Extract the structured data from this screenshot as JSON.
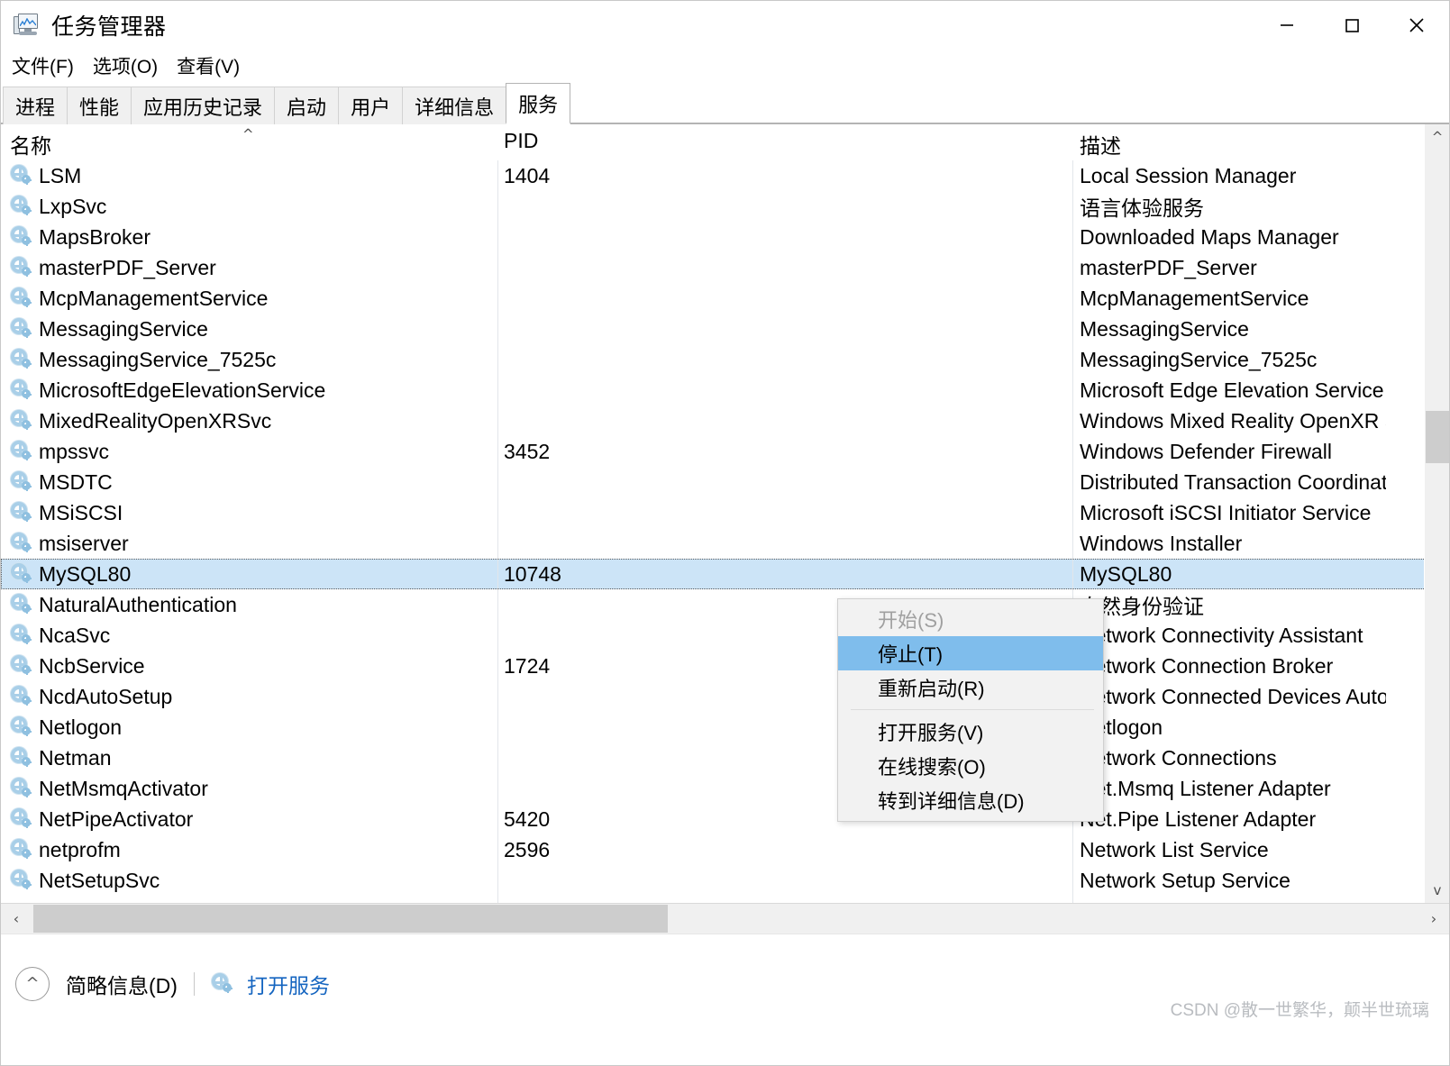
{
  "window": {
    "title": "任务管理器",
    "icon": "task-manager-icon",
    "controls": {
      "minimize": "—",
      "maximize": "□",
      "close": "✕"
    }
  },
  "menubar": {
    "items": [
      {
        "label": "文件(F)"
      },
      {
        "label": "选项(O)"
      },
      {
        "label": "查看(V)"
      }
    ]
  },
  "tabs": [
    {
      "label": "进程",
      "active": false
    },
    {
      "label": "性能",
      "active": false
    },
    {
      "label": "应用历史记录",
      "active": false
    },
    {
      "label": "启动",
      "active": false
    },
    {
      "label": "用户",
      "active": false
    },
    {
      "label": "详细信息",
      "active": false
    },
    {
      "label": "服务",
      "active": true
    }
  ],
  "table": {
    "columns": [
      {
        "key": "name",
        "label": "名称",
        "sort": "asc",
        "sort_caret": "^"
      },
      {
        "key": "pid",
        "label": "PID"
      },
      {
        "key": "desc",
        "label": "描述"
      }
    ],
    "rows": [
      {
        "name": "LSM",
        "pid": "1404",
        "desc": "Local Session Manager",
        "icon": "service-gear-icon",
        "selected": false
      },
      {
        "name": "LxpSvc",
        "pid": "",
        "desc": "语言体验服务",
        "icon": "service-gear-icon",
        "selected": false
      },
      {
        "name": "MapsBroker",
        "pid": "",
        "desc": "Downloaded Maps Manager",
        "icon": "service-gear-icon",
        "selected": false
      },
      {
        "name": "masterPDF_Server",
        "pid": "",
        "desc": "masterPDF_Server",
        "icon": "service-gear-icon",
        "selected": false
      },
      {
        "name": "McpManagementService",
        "pid": "",
        "desc": "McpManagementService",
        "icon": "service-gear-icon",
        "selected": false
      },
      {
        "name": "MessagingService",
        "pid": "",
        "desc": "MessagingService",
        "icon": "service-gear-icon",
        "selected": false
      },
      {
        "name": "MessagingService_7525c",
        "pid": "",
        "desc": "MessagingService_7525c",
        "icon": "service-gear-icon",
        "selected": false
      },
      {
        "name": "MicrosoftEdgeElevationService",
        "pid": "",
        "desc": "Microsoft Edge Elevation Service",
        "icon": "service-gear-icon",
        "selected": false
      },
      {
        "name": "MixedRealityOpenXRSvc",
        "pid": "",
        "desc": "Windows Mixed Reality OpenXR Service",
        "icon": "service-gear-icon",
        "selected": false
      },
      {
        "name": "mpssvc",
        "pid": "3452",
        "desc": "Windows Defender Firewall",
        "icon": "service-gear-icon",
        "selected": false
      },
      {
        "name": "MSDTC",
        "pid": "",
        "desc": "Distributed Transaction Coordinator",
        "icon": "service-gear-icon",
        "selected": false
      },
      {
        "name": "MSiSCSI",
        "pid": "",
        "desc": "Microsoft iSCSI Initiator Service",
        "icon": "service-gear-icon",
        "selected": false
      },
      {
        "name": "msiserver",
        "pid": "",
        "desc": "Windows Installer",
        "icon": "service-gear-icon",
        "selected": false
      },
      {
        "name": "MySQL80",
        "pid": "10748",
        "desc": "MySQL80",
        "icon": "service-gear-icon",
        "selected": true
      },
      {
        "name": "NaturalAuthentication",
        "pid": "",
        "desc": "自然身份验证",
        "icon": "service-gear-icon",
        "selected": false
      },
      {
        "name": "NcaSvc",
        "pid": "",
        "desc": "Network Connectivity Assistant",
        "icon": "service-gear-icon",
        "selected": false
      },
      {
        "name": "NcbService",
        "pid": "1724",
        "desc": "Network Connection Broker",
        "icon": "service-gear-icon",
        "selected": false
      },
      {
        "name": "NcdAutoSetup",
        "pid": "",
        "desc": "Network Connected Devices Auto-Setup",
        "icon": "service-gear-icon",
        "selected": false
      },
      {
        "name": "Netlogon",
        "pid": "",
        "desc": "Netlogon",
        "icon": "service-gear-icon",
        "selected": false
      },
      {
        "name": "Netman",
        "pid": "",
        "desc": "Network Connections",
        "icon": "service-gear-icon",
        "selected": false
      },
      {
        "name": "NetMsmqActivator",
        "pid": "",
        "desc": "Net.Msmq Listener Adapter",
        "icon": "service-gear-icon",
        "selected": false
      },
      {
        "name": "NetPipeActivator",
        "pid": "5420",
        "desc": "Net.Pipe Listener Adapter",
        "icon": "service-gear-icon",
        "selected": false
      },
      {
        "name": "netprofm",
        "pid": "2596",
        "desc": "Network List Service",
        "icon": "service-gear-icon",
        "selected": false
      },
      {
        "name": "NetSetupSvc",
        "pid": "",
        "desc": "Network Setup Service",
        "icon": "service-gear-icon",
        "selected": false
      }
    ]
  },
  "context_menu": {
    "items": [
      {
        "label": "开始(S)",
        "state": "disabled"
      },
      {
        "label": "停止(T)",
        "state": "highlight"
      },
      {
        "label": "重新启动(R)",
        "state": "normal"
      },
      {
        "label": "separator",
        "state": "separator"
      },
      {
        "label": "打开服务(V)",
        "state": "normal"
      },
      {
        "label": "在线搜索(O)",
        "state": "normal"
      },
      {
        "label": "转到详细信息(D)",
        "state": "normal"
      }
    ]
  },
  "scrollbars": {
    "vertical": {
      "up_arrow": "^",
      "down_arrow": "v"
    },
    "horizontal": {
      "left_arrow": "‹",
      "right_arrow": "›"
    }
  },
  "statusbar": {
    "collapse_icon": "^",
    "fewer_details_label": "简略信息(D)",
    "open_services_label": "打开服务",
    "open_services_icon": "service-gear-icon",
    "link_color": "#1565c0"
  },
  "watermark": {
    "text": "CSDN @散一世繁华，颠半世琉璃"
  },
  "colors": {
    "selection": "#cce4f7",
    "menu_highlight": "#7fbdec",
    "tab_inactive": "#f0f0f0",
    "scrollbar_thumb": "#cdcdcd"
  }
}
